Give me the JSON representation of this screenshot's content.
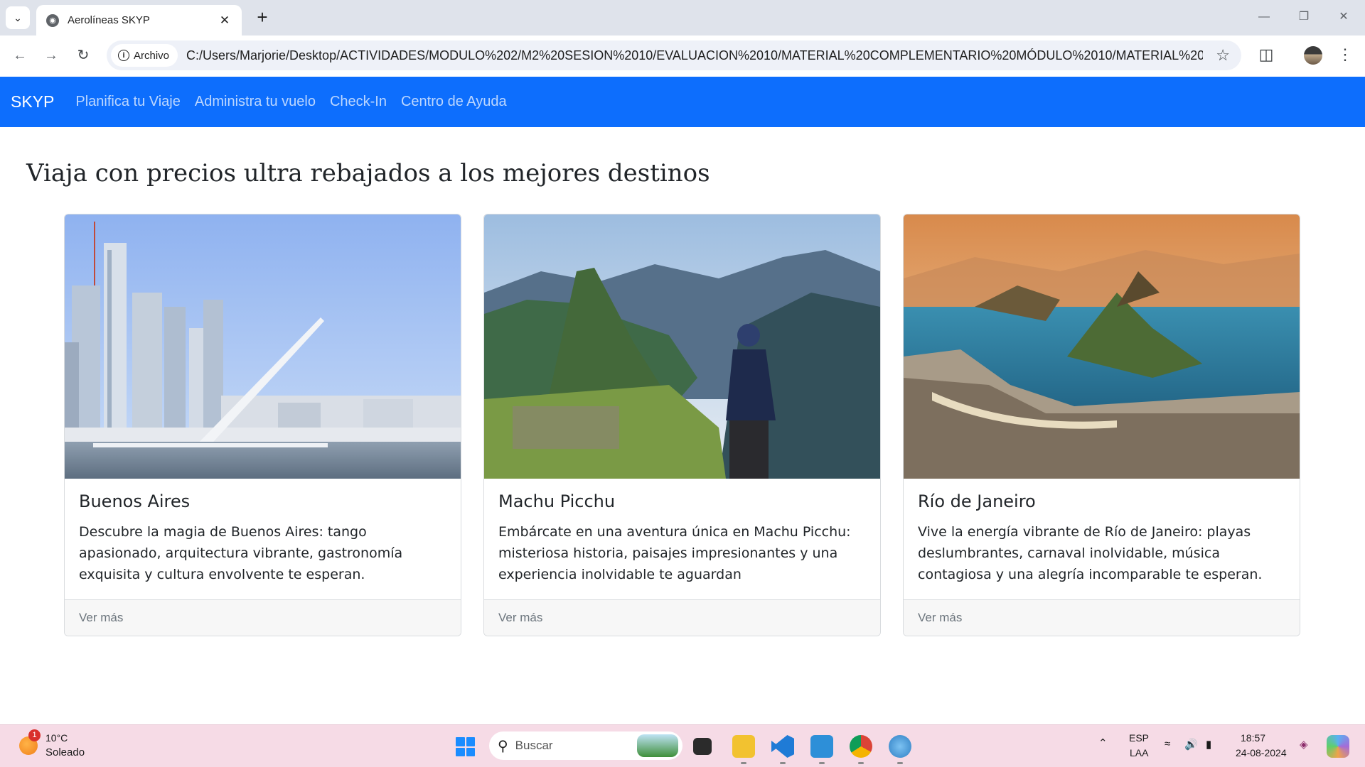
{
  "browser": {
    "tab_title": "Aerolíneas SKYP",
    "new_tab": "+",
    "site_chip": "Archivo",
    "url": "C:/Users/Marjorie/Desktop/ACTIVIDADES/MODULO%202/M2%20SESION%2010/EVALUACION%2010/MATERIAL%20COMPLEMENTARIO%20MÓDULO%2010/MATERIAL%20COMPLEME..."
  },
  "navbar": {
    "brand": "SKYP",
    "links": [
      "Planifica tu Viaje",
      "Administra tu vuelo",
      "Check-In",
      "Centro de Ayuda"
    ]
  },
  "main": {
    "heading": "Viaja con precios ultra rebajados a los mejores destinos",
    "cards": [
      {
        "title": "Buenos Aires",
        "text": "Descubre la magia de Buenos Aires: tango apasionado, arquitectura vibrante, gastronomía exquisita y cultura envolvente te esperan.",
        "footer": "Ver más"
      },
      {
        "title": "Machu Picchu",
        "text": "Embárcate en una aventura única en Machu Picchu: misteriosa historia, paisajes impresionantes y una experiencia inolvidable te aguardan",
        "footer": "Ver más"
      },
      {
        "title": "Río de Janeiro",
        "text": "Vive la energía vibrante de Río de Janeiro: playas deslumbrantes, carnaval inolvidable, música contagiosa y una alegría incomparable te esperan.",
        "footer": "Ver más"
      }
    ]
  },
  "taskbar": {
    "weather_temp": "10°C",
    "weather_condition": "Soleado",
    "weather_badge": "1",
    "search_placeholder": "Buscar",
    "lang_top": "ESP",
    "lang_bottom": "LAA",
    "time": "18:57",
    "date": "24-08-2024"
  },
  "colors": {
    "navbar": "#0d6efd",
    "tabstrip": "#dfe3eb",
    "taskbar": "#f6dbe6"
  }
}
